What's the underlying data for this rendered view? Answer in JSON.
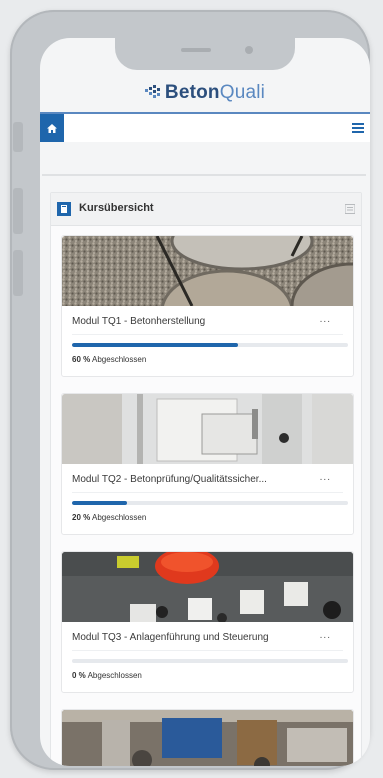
{
  "brand": {
    "name_bold": "Beton",
    "name_light": "Quali"
  },
  "nav": {
    "home_icon": "home-icon",
    "menu_icon": "hamburger-menu-icon"
  },
  "course_overview": {
    "title": "Kursübersicht",
    "icon": "course-overview-icon",
    "courses": [
      {
        "title": "Modul TQ1 - Betonherstellung",
        "more": "...",
        "progress": 60,
        "progress_label": "60 %",
        "status": "Abgeschlossen"
      },
      {
        "title": "Modul TQ2 - Betonprüfung/Qualitätssicher...",
        "more": "...",
        "progress": 20,
        "progress_label": "20 %",
        "status": "Abgeschlossen"
      },
      {
        "title": "Modul TQ3 - Anlagenführung und Steuerung",
        "more": "...",
        "progress": 0,
        "progress_label": "0 %",
        "status": "Abgeschlossen"
      }
    ]
  },
  "colors": {
    "primary": "#1f66ac",
    "brand_dark": "#2c4f7d",
    "brand_light": "#5a88c0"
  }
}
